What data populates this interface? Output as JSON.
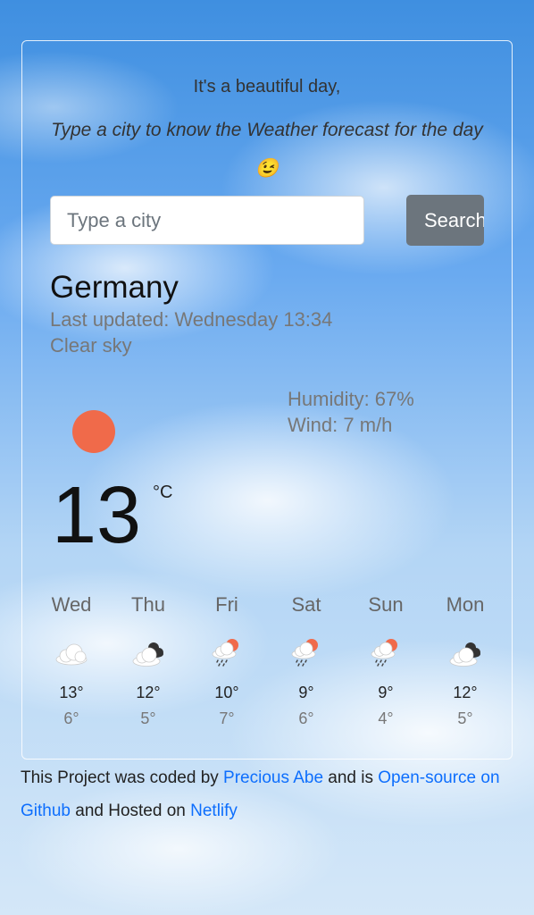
{
  "header": {
    "greeting": "It's a beautiful day,",
    "tagline": "Type a city to know the Weather forecast for the day😉"
  },
  "search": {
    "placeholder": "Type a city",
    "value": "",
    "button_label": "Search"
  },
  "current": {
    "city": "Germany",
    "last_updated": "Last updated: Wednesday 13:34",
    "description": "Clear sky",
    "humidity": "Humidity: 67%",
    "wind": "Wind: 7 m/h",
    "temperature": "13",
    "unit": "°C",
    "icon": "clear-sky-sun-icon"
  },
  "forecast": [
    {
      "day": "Wed",
      "max": "13°",
      "min": "6°",
      "icon": "cloud"
    },
    {
      "day": "Thu",
      "max": "12°",
      "min": "5°",
      "icon": "cloudy"
    },
    {
      "day": "Fri",
      "max": "10°",
      "min": "7°",
      "icon": "rain-sun"
    },
    {
      "day": "Sat",
      "max": "9°",
      "min": "6°",
      "icon": "rain-sun"
    },
    {
      "day": "Sun",
      "max": "9°",
      "min": "4°",
      "icon": "rain-sun"
    },
    {
      "day": "Mon",
      "max": "12°",
      "min": "5°",
      "icon": "cloudy"
    }
  ],
  "footer": {
    "text_1": "This Project was coded by ",
    "author_link": "Precious Abe",
    "text_2": " and is ",
    "source_link": "Open-source on Github",
    "text_3": " and Hosted on ",
    "host_link": "Netlify"
  },
  "colors": {
    "sun": "#f06a4a",
    "link": "#0d6efd",
    "button": "#6c757d",
    "cloud_dark": "#333333"
  }
}
